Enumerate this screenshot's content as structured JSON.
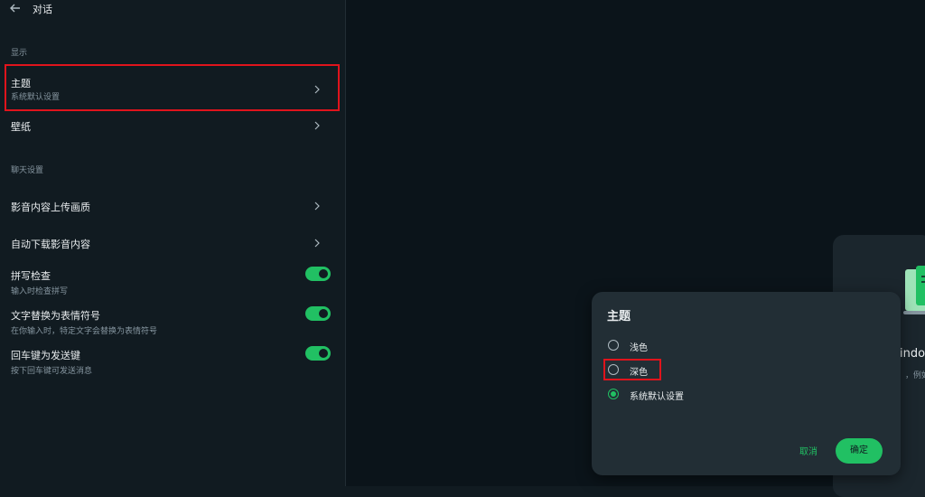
{
  "header": {
    "title": "对话"
  },
  "sections": {
    "display": "显示",
    "chat": "聊天设置"
  },
  "rows": {
    "theme": {
      "label": "主题",
      "sub": "系统默认设置"
    },
    "wallpaper": {
      "label": "壁纸"
    },
    "media_quality": {
      "label": "影音内容上传画质"
    },
    "auto_download": {
      "label": "自动下载影音内容"
    },
    "spell_check": {
      "label": "拼写检查",
      "sub": "输入时检查拼写",
      "enabled": true
    },
    "emoji_replace": {
      "label": "文字替换为表情符号",
      "sub": "在你输入时，特定文字会替换为表情符号",
      "enabled": true
    },
    "enter_send": {
      "label": "回车键为发送键",
      "sub": "按下回车键可发送消息",
      "enabled": true
    }
  },
  "background_card": {
    "partial_title": "indo",
    "partial_sub": "，例如"
  },
  "dialog": {
    "title": "主题",
    "options": [
      "浅色",
      "深色",
      "系统默认设置"
    ],
    "selected": "系统默认设置",
    "cancel": "取消",
    "ok": "确定"
  },
  "colors": {
    "accent": "#21c063",
    "highlight": "#e0141c",
    "bg": "#111b21"
  }
}
